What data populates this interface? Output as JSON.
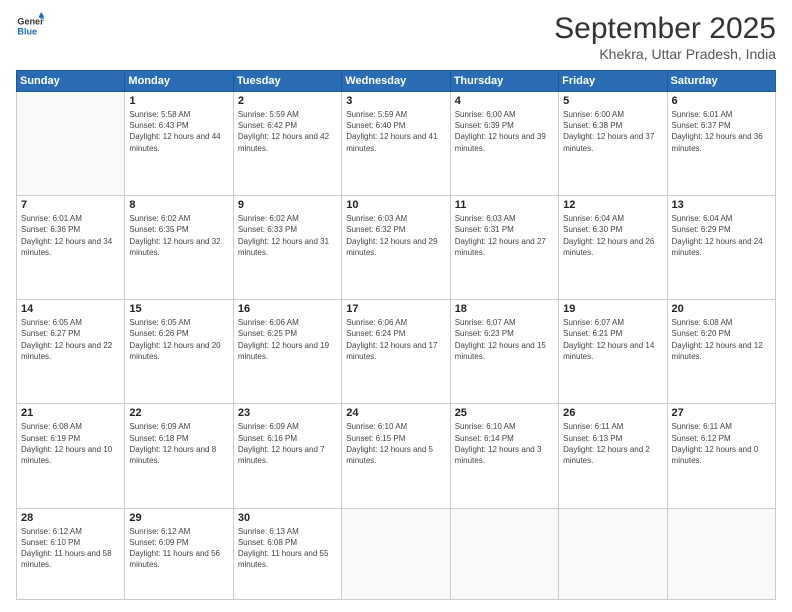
{
  "logo": {
    "line1": "General",
    "line2": "Blue"
  },
  "header": {
    "month": "September 2025",
    "location": "Khekra, Uttar Pradesh, India"
  },
  "weekdays": [
    "Sunday",
    "Monday",
    "Tuesday",
    "Wednesday",
    "Thursday",
    "Friday",
    "Saturday"
  ],
  "weeks": [
    [
      null,
      {
        "day": 1,
        "sunrise": "5:58 AM",
        "sunset": "6:43 PM",
        "daylight": "12 hours and 44 minutes."
      },
      {
        "day": 2,
        "sunrise": "5:59 AM",
        "sunset": "6:42 PM",
        "daylight": "12 hours and 42 minutes."
      },
      {
        "day": 3,
        "sunrise": "5:59 AM",
        "sunset": "6:40 PM",
        "daylight": "12 hours and 41 minutes."
      },
      {
        "day": 4,
        "sunrise": "6:00 AM",
        "sunset": "6:39 PM",
        "daylight": "12 hours and 39 minutes."
      },
      {
        "day": 5,
        "sunrise": "6:00 AM",
        "sunset": "6:38 PM",
        "daylight": "12 hours and 37 minutes."
      },
      {
        "day": 6,
        "sunrise": "6:01 AM",
        "sunset": "6:37 PM",
        "daylight": "12 hours and 36 minutes."
      }
    ],
    [
      {
        "day": 7,
        "sunrise": "6:01 AM",
        "sunset": "6:36 PM",
        "daylight": "12 hours and 34 minutes."
      },
      {
        "day": 8,
        "sunrise": "6:02 AM",
        "sunset": "6:35 PM",
        "daylight": "12 hours and 32 minutes."
      },
      {
        "day": 9,
        "sunrise": "6:02 AM",
        "sunset": "6:33 PM",
        "daylight": "12 hours and 31 minutes."
      },
      {
        "day": 10,
        "sunrise": "6:03 AM",
        "sunset": "6:32 PM",
        "daylight": "12 hours and 29 minutes."
      },
      {
        "day": 11,
        "sunrise": "6:03 AM",
        "sunset": "6:31 PM",
        "daylight": "12 hours and 27 minutes."
      },
      {
        "day": 12,
        "sunrise": "6:04 AM",
        "sunset": "6:30 PM",
        "daylight": "12 hours and 26 minutes."
      },
      {
        "day": 13,
        "sunrise": "6:04 AM",
        "sunset": "6:29 PM",
        "daylight": "12 hours and 24 minutes."
      }
    ],
    [
      {
        "day": 14,
        "sunrise": "6:05 AM",
        "sunset": "6:27 PM",
        "daylight": "12 hours and 22 minutes."
      },
      {
        "day": 15,
        "sunrise": "6:05 AM",
        "sunset": "6:26 PM",
        "daylight": "12 hours and 20 minutes."
      },
      {
        "day": 16,
        "sunrise": "6:06 AM",
        "sunset": "6:25 PM",
        "daylight": "12 hours and 19 minutes."
      },
      {
        "day": 17,
        "sunrise": "6:06 AM",
        "sunset": "6:24 PM",
        "daylight": "12 hours and 17 minutes."
      },
      {
        "day": 18,
        "sunrise": "6:07 AM",
        "sunset": "6:23 PM",
        "daylight": "12 hours and 15 minutes."
      },
      {
        "day": 19,
        "sunrise": "6:07 AM",
        "sunset": "6:21 PM",
        "daylight": "12 hours and 14 minutes."
      },
      {
        "day": 20,
        "sunrise": "6:08 AM",
        "sunset": "6:20 PM",
        "daylight": "12 hours and 12 minutes."
      }
    ],
    [
      {
        "day": 21,
        "sunrise": "6:08 AM",
        "sunset": "6:19 PM",
        "daylight": "12 hours and 10 minutes."
      },
      {
        "day": 22,
        "sunrise": "6:09 AM",
        "sunset": "6:18 PM",
        "daylight": "12 hours and 8 minutes."
      },
      {
        "day": 23,
        "sunrise": "6:09 AM",
        "sunset": "6:16 PM",
        "daylight": "12 hours and 7 minutes."
      },
      {
        "day": 24,
        "sunrise": "6:10 AM",
        "sunset": "6:15 PM",
        "daylight": "12 hours and 5 minutes."
      },
      {
        "day": 25,
        "sunrise": "6:10 AM",
        "sunset": "6:14 PM",
        "daylight": "12 hours and 3 minutes."
      },
      {
        "day": 26,
        "sunrise": "6:11 AM",
        "sunset": "6:13 PM",
        "daylight": "12 hours and 2 minutes."
      },
      {
        "day": 27,
        "sunrise": "6:11 AM",
        "sunset": "6:12 PM",
        "daylight": "12 hours and 0 minutes."
      }
    ],
    [
      {
        "day": 28,
        "sunrise": "6:12 AM",
        "sunset": "6:10 PM",
        "daylight": "11 hours and 58 minutes."
      },
      {
        "day": 29,
        "sunrise": "6:12 AM",
        "sunset": "6:09 PM",
        "daylight": "11 hours and 56 minutes."
      },
      {
        "day": 30,
        "sunrise": "6:13 AM",
        "sunset": "6:08 PM",
        "daylight": "11 hours and 55 minutes."
      },
      null,
      null,
      null,
      null
    ]
  ]
}
